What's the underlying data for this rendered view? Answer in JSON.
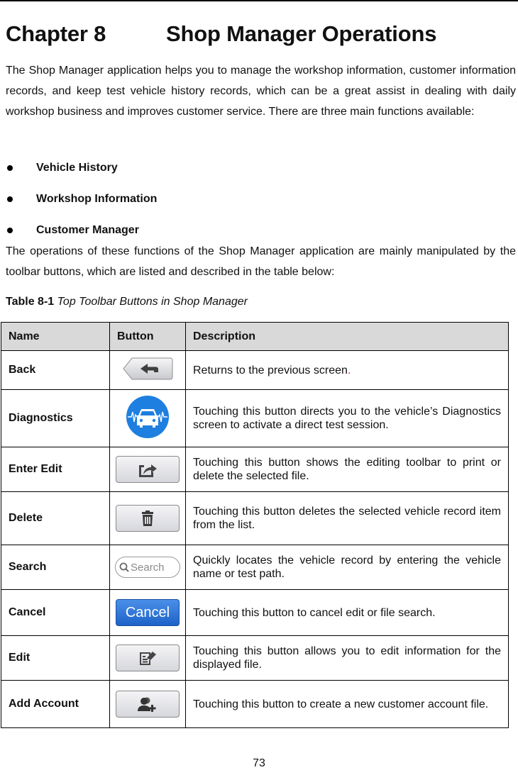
{
  "chapter": {
    "number": "Chapter 8",
    "title": "Shop Manager Operations"
  },
  "intro_paragraph": "The Shop Manager application helps you to manage the workshop information, customer information records, and keep test vehicle history records, which can be a great assist in dealing with daily workshop business and improves customer service. There are three main functions available:",
  "functions": [
    {
      "label": "Vehicle History"
    },
    {
      "label": "Workshop Information"
    },
    {
      "label": "Customer Manager"
    }
  ],
  "outro_paragraph": "The operations of these functions of the Shop Manager application are mainly manipulated by the toolbar buttons, which are listed and described in the table below:",
  "table": {
    "caption_label": "Table 8-1",
    "caption_text": "Top Toolbar Buttons in Shop Manager",
    "headers": {
      "name": "Name",
      "button": "Button",
      "description": "Description"
    },
    "rows": [
      {
        "name": "Back",
        "icon": "back-arrow-icon",
        "description": "Returns to the previous screen",
        "description_suffix": "."
      },
      {
        "name": "Diagnostics",
        "icon": "car-diagnostics-icon",
        "description": "Touching this button directs you to the vehicle’s Diagnostics screen to activate a direct test session."
      },
      {
        "name": "Enter Edit",
        "icon": "share-export-icon",
        "description": "Touching this button shows the editing toolbar to print or delete the selected file."
      },
      {
        "name": "Delete",
        "icon": "trash-icon",
        "description": "Touching this button deletes the selected vehicle record item from the list."
      },
      {
        "name": "Search",
        "icon": "search-icon",
        "button_text": "Search",
        "description": "Quickly locates the vehicle record by entering the vehicle name or test path."
      },
      {
        "name": "Cancel",
        "icon": "cancel-button",
        "button_text": "Cancel",
        "description": "Touching this button to cancel edit or file search."
      },
      {
        "name": "Edit",
        "icon": "edit-document-icon",
        "description": "Touching this button allows you to edit information for the displayed file."
      },
      {
        "name": "Add Account",
        "icon": "add-user-icon",
        "description": "Touching this button to create a new customer account file."
      }
    ]
  },
  "colors": {
    "header_bg": "#d9d9d9",
    "diagnostics_blue": "#1e7fe0",
    "cancel_blue": "#2a6fd6",
    "accent_red": "#e02020"
  },
  "page_number": "73"
}
